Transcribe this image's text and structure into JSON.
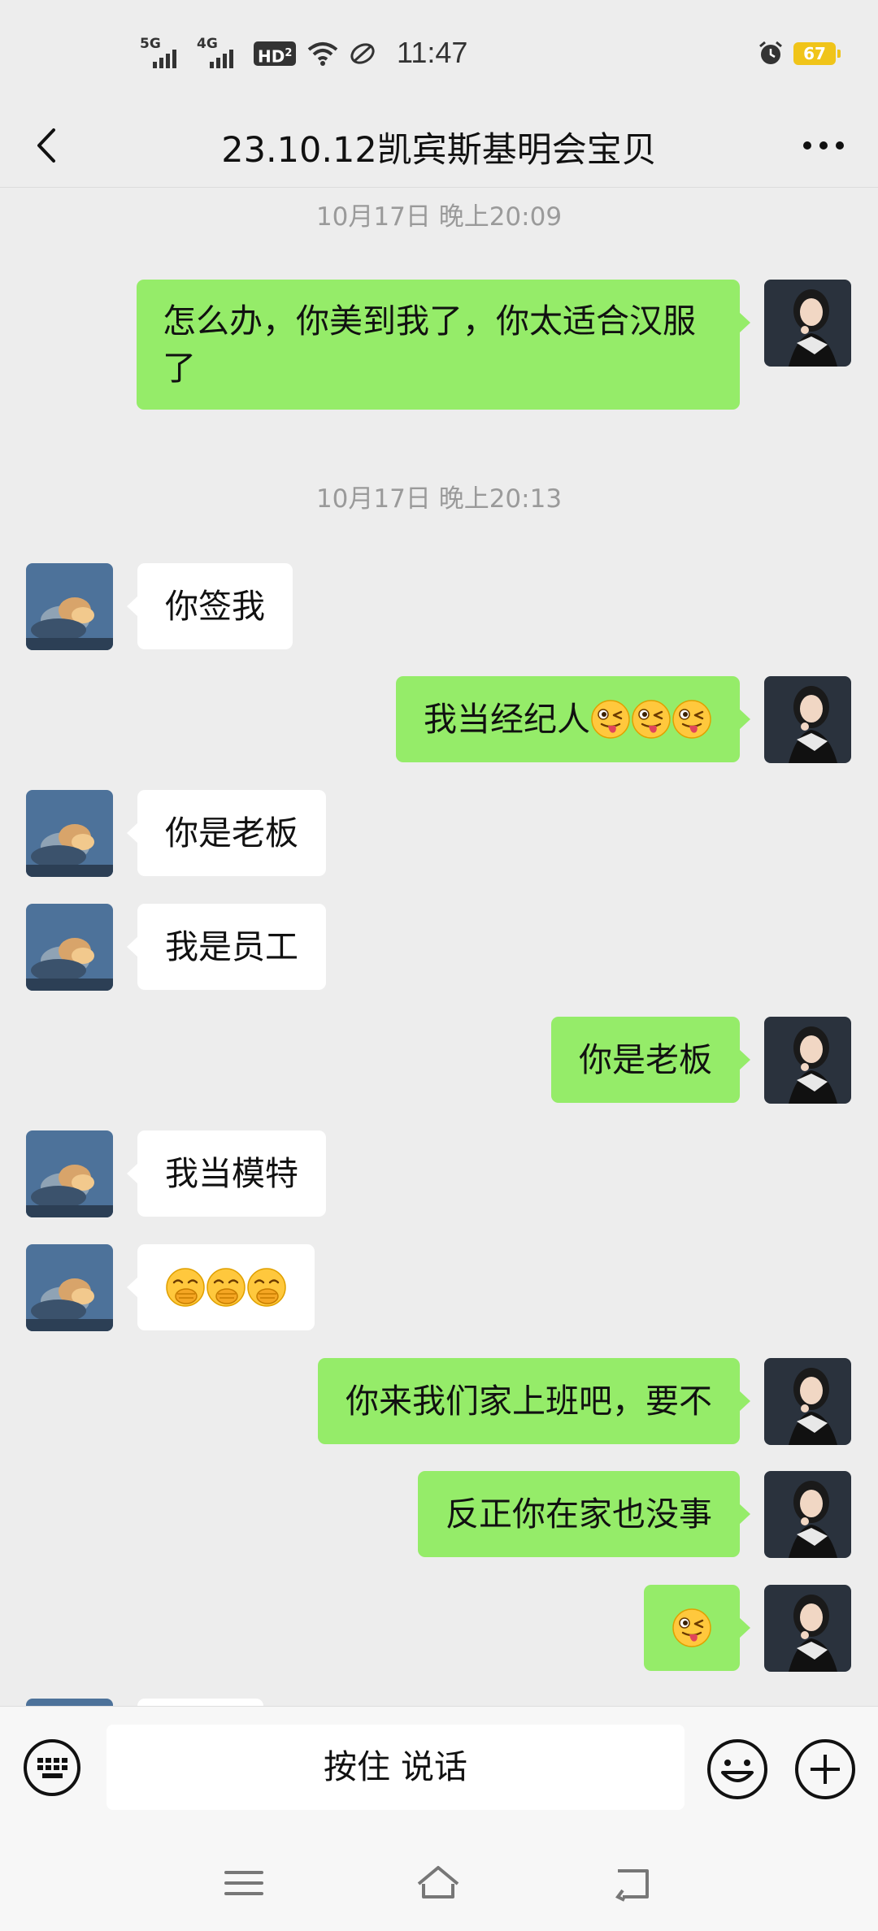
{
  "status_bar": {
    "time": "11:47",
    "net1": "5G",
    "net2": "4G",
    "hd": "HD",
    "hd_sup": "2",
    "battery": "67"
  },
  "header": {
    "title": "23.10.12凯宾斯基明会宝贝"
  },
  "timestamps": [
    "10月17日 晚上20:09",
    "10月17日 晚上20:13"
  ],
  "messages": [
    {
      "side": "out",
      "text": "怎么办，你美到我了，你太适合汉服了"
    },
    {
      "side": "in",
      "text": "你签我"
    },
    {
      "side": "out",
      "text": "我当经纪人",
      "emoji": "wink-tongue",
      "emoji_count": 3
    },
    {
      "side": "in",
      "text": "你是老板"
    },
    {
      "side": "in",
      "text": "我是员工"
    },
    {
      "side": "out",
      "text": "你是老板"
    },
    {
      "side": "in",
      "text": "我当模特"
    },
    {
      "side": "in",
      "text": "",
      "emoji": "hand-over-mouth",
      "emoji_count": 3
    },
    {
      "side": "out",
      "text": "你来我们家上班吧，要不"
    },
    {
      "side": "out",
      "text": "反正你在家也没事"
    },
    {
      "side": "out",
      "text": "",
      "emoji": "wink-tongue",
      "emoji_count": 1
    }
  ],
  "input_bar": {
    "voice_label": "按住 说话"
  },
  "colors": {
    "background": "#ededed",
    "bubble_out": "#95ec69",
    "bubble_in": "#ffffff",
    "battery": "#f0c419"
  },
  "icons": [
    "back-arrow-icon",
    "more-icon",
    "keyboard-icon",
    "emoji-icon",
    "plus-icon",
    "menu-icon",
    "home-icon",
    "back-nav-icon"
  ]
}
